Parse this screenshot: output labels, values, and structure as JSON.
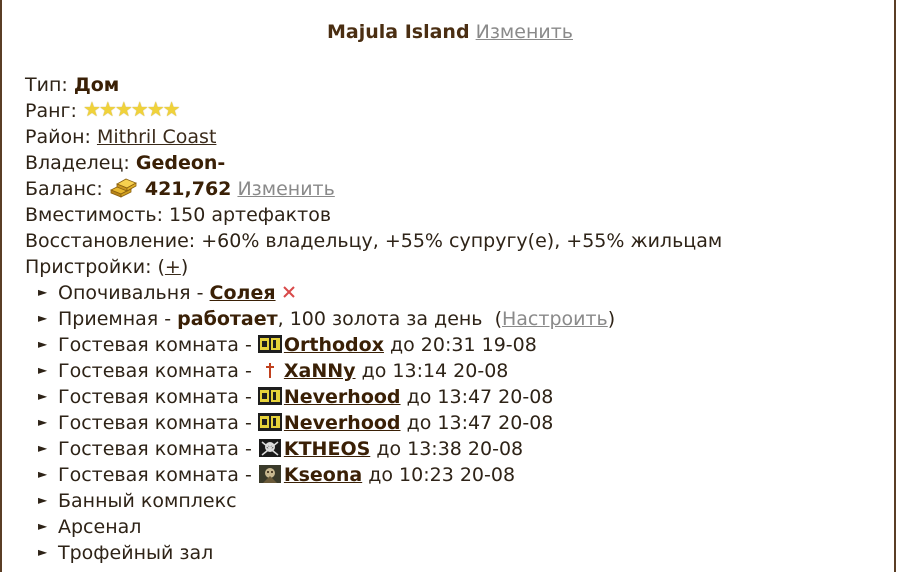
{
  "header": {
    "title": "Majula Island",
    "change_label": "Изменить"
  },
  "info": {
    "type_label": "Тип:",
    "type_value": "Дом",
    "rank_label": "Ранг:",
    "rank_stars": 6,
    "district_label": "Район:",
    "district_value": "Mithril Coast",
    "owner_label": "Владелец:",
    "owner_value": "Gedeon-",
    "balance_label": "Баланс:",
    "balance_value": "421,762",
    "balance_change_label": "Изменить",
    "capacity_text": "Вместимость: 150 артефактов",
    "recovery_text": "Восстановление: +60% владельцу, +55% супругу(е), +55% жильцам",
    "extensions_label": "Пристройки: (",
    "extensions_add": "+",
    "extensions_close": ")"
  },
  "rooms": {
    "bedroom": {
      "label": "Опочивальня - ",
      "occupant": "Солея"
    },
    "reception": {
      "label": "Приемная - ",
      "status": "работает",
      "price_text": ", 100 золота за день  (",
      "configure_label": "Настроить",
      "close_paren": ")"
    },
    "guests": [
      {
        "label": "Гостевая комната - ",
        "icon": "clan-emblem-icon",
        "name": "Orthodox",
        "until": " до 20:31 19-08"
      },
      {
        "label": "Гостевая комната - ",
        "icon": "dagger-emblem-icon",
        "name": "XaNNy",
        "until": " до 13:14 20-08"
      },
      {
        "label": "Гостевая комната - ",
        "icon": "clan-emblem-icon",
        "name": "Neverhood",
        "until": " до 13:47 20-08"
      },
      {
        "label": "Гостевая комната - ",
        "icon": "clan-emblem-icon",
        "name": "Neverhood",
        "until": " до 13:47 20-08"
      },
      {
        "label": "Гостевая комната - ",
        "icon": "skull-emblem-icon",
        "name": "KTHEOS",
        "until": " до 13:38 20-08"
      },
      {
        "label": "Гостевая комната - ",
        "icon": "warrior-emblem-icon",
        "name": "Kseona",
        "until": " до 10:23 20-08"
      }
    ],
    "others": [
      {
        "label": "Банный комплекс"
      },
      {
        "label": "Арсенал"
      },
      {
        "label": "Трофейный зал"
      }
    ]
  },
  "colors": {
    "border": "#5a3d25",
    "bold_text": "#3a2006",
    "star": "#f0d23a",
    "remove_x": "#d84a4a"
  }
}
